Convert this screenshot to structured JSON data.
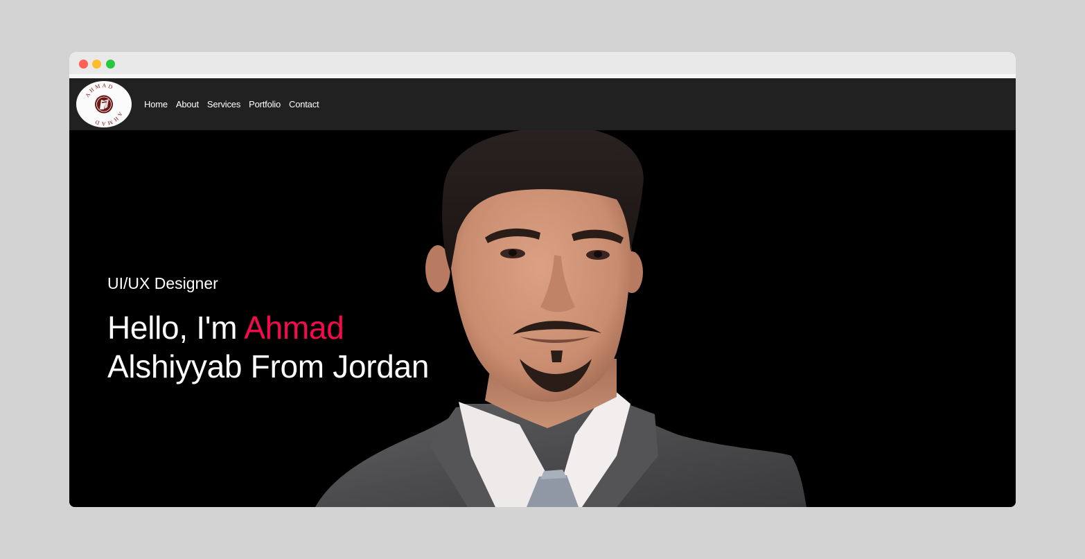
{
  "window": {
    "controls": [
      "close",
      "minimize",
      "zoom"
    ],
    "colors": {
      "close": "#fe5f57",
      "minimize": "#febc2e",
      "zoom": "#28c840"
    }
  },
  "navbar": {
    "logo_text": "AHMAD",
    "links": [
      {
        "label": "Home"
      },
      {
        "label": "About"
      },
      {
        "label": "Services"
      },
      {
        "label": "Portfolio"
      },
      {
        "label": "Contact"
      }
    ],
    "background": "#212121"
  },
  "hero": {
    "role": "UI/UX Designer",
    "greeting": "Hello, I'm",
    "first_name": "Ahmad",
    "rest_line": "Alshiyyab From Jordan",
    "accent_color": "#f50b4d",
    "background": "#000000",
    "portrait_icon": "person-portrait-photo"
  }
}
